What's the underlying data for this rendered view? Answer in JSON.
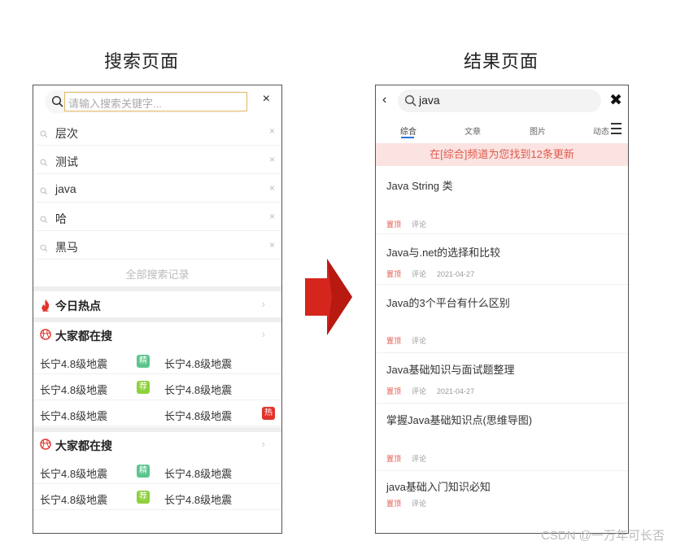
{
  "headings": {
    "left": "搜索页面",
    "right": "结果页面"
  },
  "search_page": {
    "input_placeholder": "请输入搜索关键字...",
    "close": "×",
    "history": [
      {
        "text": "层次",
        "delete": "×"
      },
      {
        "text": "测试",
        "delete": "×"
      },
      {
        "text": "java",
        "delete": "×"
      },
      {
        "text": "哈",
        "delete": "×"
      },
      {
        "text": "黑马",
        "delete": "×"
      }
    ],
    "all_history_label": "全部搜索记录",
    "today_hot": {
      "title": "今日热点",
      "chevron": "›"
    },
    "popular_sections": [
      {
        "title": "大家都在搜",
        "chevron": "›",
        "rows": [
          {
            "left": "长宁4.8级地震",
            "right": "长宁4.8级地震",
            "badge": "精",
            "badge_color": "#5cc58e"
          },
          {
            "left": "长宁4.8级地震",
            "right": "长宁4.8级地震",
            "badge": "荐",
            "badge_color": "#8fd03e"
          },
          {
            "left": "长宁4.8级地震",
            "right": "长宁4.8级地震",
            "badge": "热",
            "badge_color": "#e2332b"
          }
        ]
      },
      {
        "title": "大家都在搜",
        "chevron": "›",
        "rows": [
          {
            "left": "长宁4.8级地震",
            "right": "长宁4.8级地震",
            "badge": "精",
            "badge_color": "#5cc58e"
          },
          {
            "left": "长宁4.8级地震",
            "right": "长宁4.8级地震",
            "badge": "荐",
            "badge_color": "#8fd03e"
          }
        ]
      }
    ]
  },
  "result_page": {
    "back": "‹",
    "query": "java",
    "close": "✖",
    "tabs": [
      "综合",
      "文章",
      "图片",
      "动态"
    ],
    "active_tab": "综合",
    "banner": "在[综合]频道为您找到12条更新",
    "articles": [
      {
        "title": "Java String 类",
        "top": "置顶",
        "comment": "评论",
        "date": ""
      },
      {
        "title": "Java与.net的选择和比较",
        "top": "置顶",
        "comment": "评论",
        "date": "2021-04-27"
      },
      {
        "title": "Java的3个平台有什么区别",
        "top": "置顶",
        "comment": "评论",
        "date": ""
      },
      {
        "title": "Java基础知识与面试题整理",
        "top": "置顶",
        "comment": "评论",
        "date": "2021-04-27"
      },
      {
        "title": "掌握Java基础知识点(思维导图)",
        "top": "置顶",
        "comment": "评论",
        "date": ""
      },
      {
        "title": "java基础入门知识必知",
        "top": "置顶",
        "comment": "评论",
        "date": ""
      }
    ]
  },
  "colors": {
    "accent_red": "#e05a4f",
    "arrow_red": "#d6251c",
    "tab_blue": "#2a74d8",
    "input_border": "#e2b766"
  },
  "watermark": "CSDN @一万年可长否"
}
